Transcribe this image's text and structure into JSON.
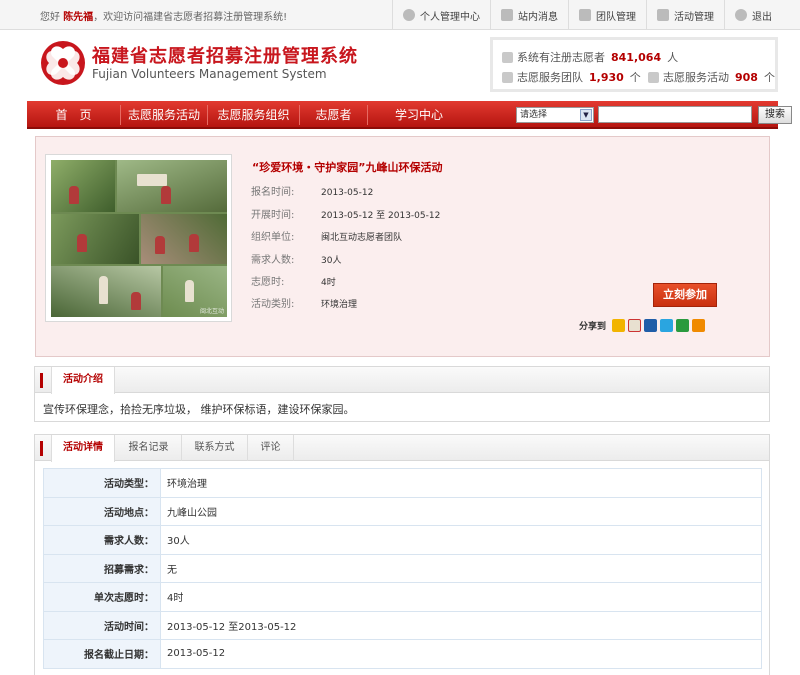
{
  "topbar": {
    "greeting_prefix": "您好",
    "user_name": "陈先福",
    "greeting_suffix": "，欢迎访问福建省志愿者招募注册管理系统!",
    "links": [
      {
        "label": "个人管理中心",
        "icon": "user-icon"
      },
      {
        "label": "站内消息",
        "icon": "mail-icon"
      },
      {
        "label": "团队管理",
        "icon": "team-icon"
      },
      {
        "label": "活动管理",
        "icon": "activity-icon"
      },
      {
        "label": "退出",
        "icon": "logout-icon"
      }
    ]
  },
  "header": {
    "title": "福建省志愿者招募注册管理系统",
    "subtitle": "Fujian Volunteers Management System",
    "logo_color": "#c8161d"
  },
  "stats": {
    "volunteers_label": "系统有注册志愿者",
    "volunteers_value": "841,064",
    "volunteers_unit": "人",
    "teams_label": "志愿服务团队",
    "teams_value": "1,930",
    "teams_unit": "个",
    "activities_label": "志愿服务活动",
    "activities_value": "908",
    "activities_unit": "个"
  },
  "nav": {
    "items": [
      "首　页",
      "志愿服务活动",
      "志愿服务组织",
      "志愿者",
      "学习中心"
    ],
    "select_value": "请选择",
    "search_button": "搜索",
    "accent": "#c8161d"
  },
  "activity": {
    "title": "“珍爱环境・守护家园”九峰山环保活动",
    "fields": [
      {
        "label": "报名时间:",
        "value": "2013-05-12"
      },
      {
        "label": "开展时间:",
        "value": "2013-05-12 至 2013-05-12"
      },
      {
        "label": "组织单位:",
        "value": "闽北互动志愿者团队"
      },
      {
        "label": "需求人数:",
        "value": "30人"
      },
      {
        "label": "志愿时:",
        "value": "4时"
      },
      {
        "label": "活动类别:",
        "value": "环境治理"
      }
    ],
    "join_button": "立刻参加",
    "share_label": "分享到",
    "share_icons": [
      "qzone-icon",
      "weibo-icon",
      "renren-icon",
      "tencent-icon",
      "douban-icon",
      "more-share-icon"
    ],
    "photo_watermark": "闽北互动"
  },
  "intro": {
    "tab_label": "活动介绍",
    "text": "宣传环保理念，拾捡无序垃圾，  维护环保标语，建设环保家园。"
  },
  "details": {
    "tabs": [
      "活动详情",
      "报名记录",
      "联系方式",
      "评论"
    ],
    "rows": [
      {
        "key": "活动类型：",
        "value": "环境治理"
      },
      {
        "key": "活动地点：",
        "value": "九峰山公园"
      },
      {
        "key": "需求人数：",
        "value": "30人"
      },
      {
        "key": "招募需求：",
        "value": "无"
      },
      {
        "key": "单次志愿时：",
        "value": "4时"
      },
      {
        "key": "活动时间：",
        "value": "2013-05-12 至2013-05-12"
      },
      {
        "key": "报名截止日期：",
        "value": "2013-05-12"
      }
    ]
  }
}
